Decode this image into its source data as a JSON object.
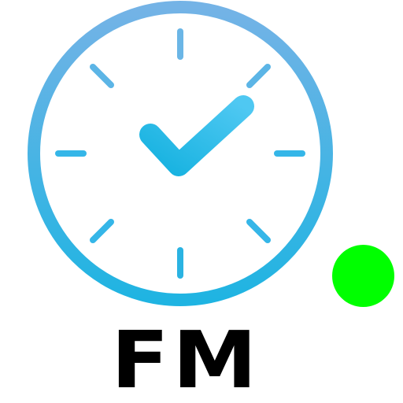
{
  "app": {
    "label": "FM"
  },
  "icons": {
    "main": "clock-check-icon",
    "status": "online-status-dot"
  },
  "colors": {
    "clock_ring_top": "#74b3e6",
    "clock_ring_bottom": "#1fb4e2",
    "clock_ticks": "#35b6e8",
    "check_top": "#4fc8f2",
    "check_bottom": "#16b2e0",
    "status_dot": "#00ff00",
    "label": "#000000",
    "background": "#ffffff"
  }
}
